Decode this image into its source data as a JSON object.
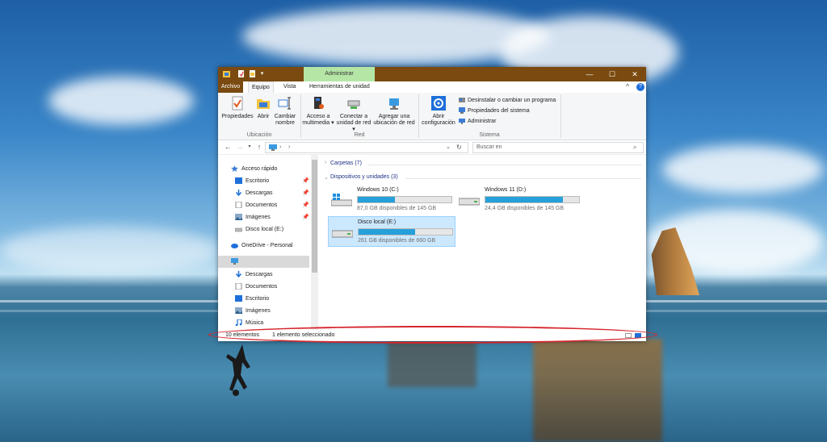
{
  "titlebar": {
    "context_tab": "Administrar",
    "qat_icons": [
      "explorer-icon",
      "properties-icon",
      "new-folder-icon",
      "dropdown-icon"
    ],
    "buttons": [
      "minimize-icon",
      "maximize-icon",
      "close-icon"
    ]
  },
  "tabs": {
    "archivo": "Archivo",
    "equipo": "Equipo",
    "vista": "Vista",
    "herramientas": "Herramientas de unidad"
  },
  "ribbon": {
    "ubicacion": {
      "group_label": "Ubicación",
      "propiedades": "Propiedades",
      "abrir": "Abrir",
      "cambiar_line1": "Cambiar",
      "cambiar_line2": "nombre"
    },
    "red": {
      "group_label": "Red",
      "acceso_line1": "Acceso a",
      "acceso_line2": "multimedia ▾",
      "conectar_line1": "Conectar a",
      "conectar_line2": "unidad de red ▾",
      "agregar_line1": "Agregar una",
      "agregar_line2": "ubicación de red"
    },
    "sistema": {
      "group_label": "Sistema",
      "abrir_line1": "Abrir",
      "abrir_line2": "configuración",
      "desinstalar": "Desinstalar o cambiar un programa",
      "propiedades_sistema": "Propiedades del sistema",
      "administrar": "Administrar"
    }
  },
  "addressbar": {
    "search_placeholder": "Buscar en"
  },
  "navpane": {
    "acceso_rapido": "Acceso rápido",
    "escritorio": "Escritorio",
    "descargas": "Descargas",
    "documentos": "Documentos",
    "imagenes": "Imágenes",
    "disco_local": "Disco local (E:)",
    "onedrive": "OneDrive - Personal",
    "descargas2": "Descargas",
    "documentos2": "Documentos",
    "escritorio2": "Escritorio",
    "imagenes2": "Imágenes",
    "musica": "Música"
  },
  "content": {
    "carpetas": "Carpetas (7)",
    "dispositivos": "Dispositivos y unidades (3)",
    "drives": [
      {
        "name": "Windows 10 (C:)",
        "free": "87,0 GB disponibles de 145 GB",
        "used_fraction": 0.4,
        "selected": false
      },
      {
        "name": "Windows 11 (D:)",
        "free": "24,4 GB disponibles de 145 GB",
        "used_fraction": 0.83,
        "selected": false
      },
      {
        "name": "Disco local (E:)",
        "free": "261 GB disponibles de 660 GB",
        "used_fraction": 0.6,
        "selected": true
      }
    ]
  },
  "statusbar": {
    "items_count": "10 elementos",
    "selected_count": "1 elemento seleccionado"
  },
  "colors": {
    "titlebar": "#7a4a10",
    "context_tab": "#b5e6a6",
    "drive_bar_fill": "#26a0da",
    "selection": "#cce8ff",
    "highlight_oval": "#d6262d"
  }
}
